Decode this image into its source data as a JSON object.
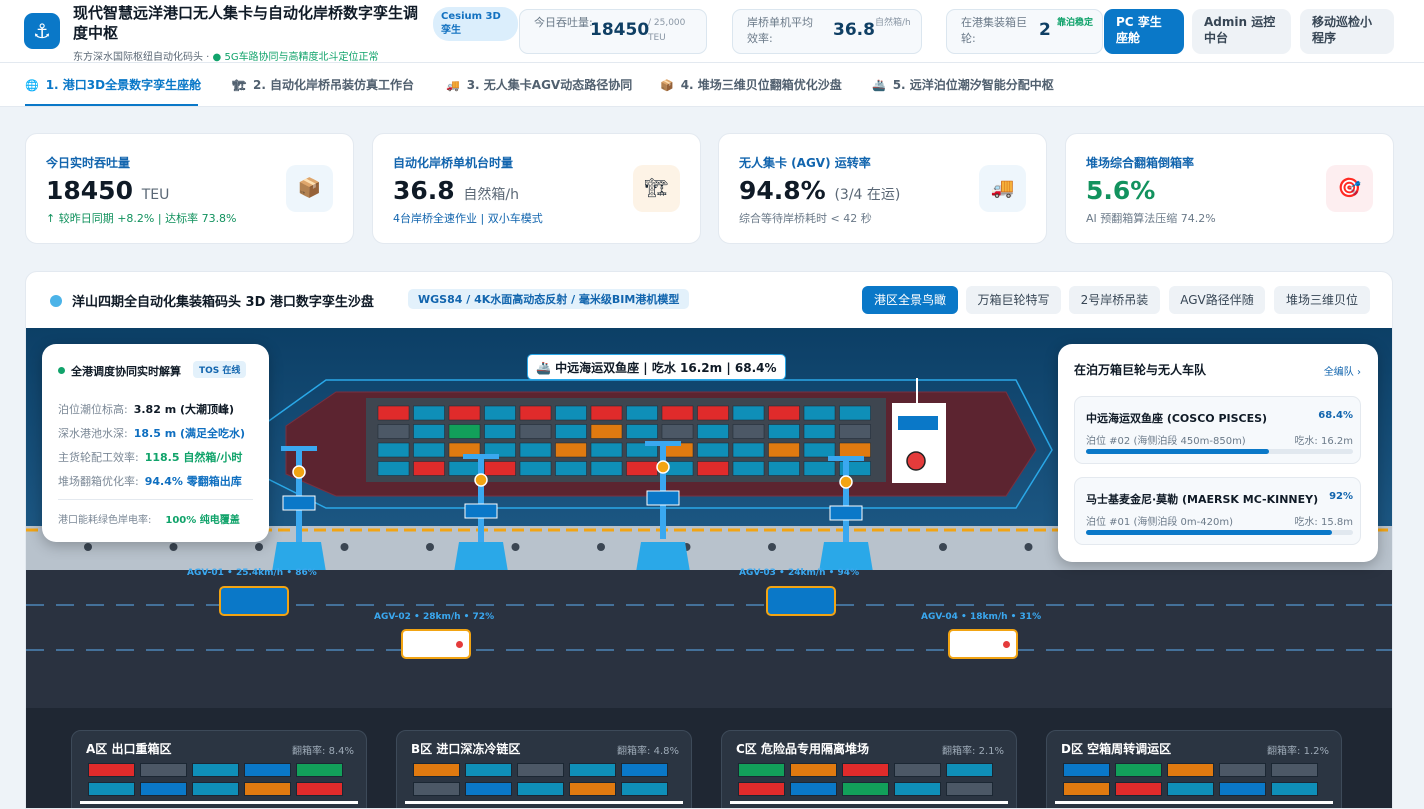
{
  "header": {
    "title": "现代智慧远洋港口无人集卡与自动化岸桥数字孪生调度中枢",
    "subtitle": "东方深水国际枢纽自动化码头 · ",
    "subtitle_status": "● 5G车路协同与高精度北斗定位正常",
    "engine_badge": "Cesium 3D 孪生",
    "kpis": [
      {
        "label": "今日吞吐量:",
        "value": "18450",
        "unit": "/ 25,000 TEU"
      },
      {
        "label": "岸桥单机平均效率:",
        "value": "36.8",
        "unit": "自然箱/h"
      },
      {
        "label": "在港集装箱巨轮:",
        "value": "2",
        "unit": "靠泊稳定"
      }
    ],
    "buttons": [
      "PC 孪生座舱",
      "Admin 运控中台",
      "移动巡检小程序"
    ],
    "logo_icon": "anchor-icon"
  },
  "tabs": [
    {
      "icon": "🌐",
      "label": "1. 港口3D全景数字孪生座舱"
    },
    {
      "icon": "🏗",
      "label": "2. 自动化岸桥吊装仿真工作台"
    },
    {
      "icon": "🚚",
      "label": "3. 无人集卡AGV动态路径协同"
    },
    {
      "icon": "📦",
      "label": "4. 堆场三维贝位翻箱优化沙盘"
    },
    {
      "icon": "🚢",
      "label": "5. 远洋泊位潮汐智能分配中枢"
    }
  ],
  "cards": [
    {
      "label": "今日实时吞吐量",
      "value": "18450",
      "unit": "TEU",
      "sub": "↑ 较昨日同期 +8.2% | 达标率 73.8%",
      "icon": "📦"
    },
    {
      "label": "自动化岸桥单机台时量",
      "value": "36.8",
      "unit": "自然箱/h",
      "sub": "4台岸桥全速作业 | 双小车模式",
      "icon": "🏗"
    },
    {
      "label": "无人集卡 (AGV) 运转率",
      "value": "94.8%",
      "unit": "(3/4 在运)",
      "sub": "综合等待岸桥耗时 < 42 秒",
      "icon": "🚚"
    },
    {
      "label": "堆场综合翻箱倒箱率",
      "value": "5.6%",
      "unit": "",
      "sub": "AI 预翻箱算法压缩 74.2%",
      "icon": "🎯"
    }
  ],
  "twin": {
    "title": "洋山四期全自动化集装箱码头 3D 港口数字孪生沙盘",
    "tag": "WGS84 / 4K水面高动态反射 / 毫米级BIM港机模型",
    "views": [
      "港区全景鸟瞰",
      "万箱巨轮特写",
      "2号岸桥吊装",
      "AGV路径伴随",
      "堆场三维贝位"
    ],
    "ship_label": "🚢 中远海运双鱼座 | 吃水 16.2m | 68.4%",
    "coordination": {
      "title": "全港调度协同实时解算",
      "badge": "TOS 在线",
      "rows": [
        {
          "label": "泊位潮位标高:",
          "value": "3.82 m (大潮顶峰)"
        },
        {
          "label": "深水港池水深:",
          "value": "18.5 m (满足全吃水)"
        },
        {
          "label": "主货轮配工效率:",
          "value": "118.5 自然箱/小时"
        },
        {
          "label": "堆场翻箱优化率:",
          "value": "94.4% 零翻箱出库"
        }
      ],
      "green_label": "港口能耗绿色岸电率:",
      "green_value": "100% 纯电覆盖"
    },
    "fleet": {
      "title": "在泊万箱巨轮与无人车队",
      "link": "全编队 ›",
      "ships": [
        {
          "name": "中远海运双鱼座 (COSCO PISCES)",
          "pct": "68.4%",
          "fill": 0.684,
          "berth": "泊位 #02 (海侧泊段 450m-850m)",
          "draft": "吃水: 16.2m"
        },
        {
          "name": "马士基麦金尼·莫勒 (MAERSK MC-KINNEY)",
          "pct": "92%",
          "fill": 0.92,
          "berth": "泊位 #01 (海侧泊段 0m-420m)",
          "draft": "吃水: 15.8m"
        }
      ]
    },
    "agvs": [
      {
        "label": "AGV-01 • 25.4km/h • 86%"
      },
      {
        "label": "AGV-02 • 28km/h • 72%"
      },
      {
        "label": "AGV-03 • 24km/h • 94%"
      },
      {
        "label": "AGV-04 • 18km/h • 31%"
      }
    ],
    "yards": [
      {
        "name": "A区 出口重箱区",
        "rate": "翻箱率: 8.4%"
      },
      {
        "name": "B区 进口深冻冷链区",
        "rate": "翻箱率: 4.8%"
      },
      {
        "name": "C区 危险品专用隔离堆场",
        "rate": "翻箱率: 2.1%"
      },
      {
        "name": "D区 空箱周转调运区",
        "rate": "翻箱率: 1.2%"
      }
    ]
  },
  "colors": {
    "accent": "#0a78c8",
    "sea": "#123e5e",
    "ok": "#11a36b"
  }
}
